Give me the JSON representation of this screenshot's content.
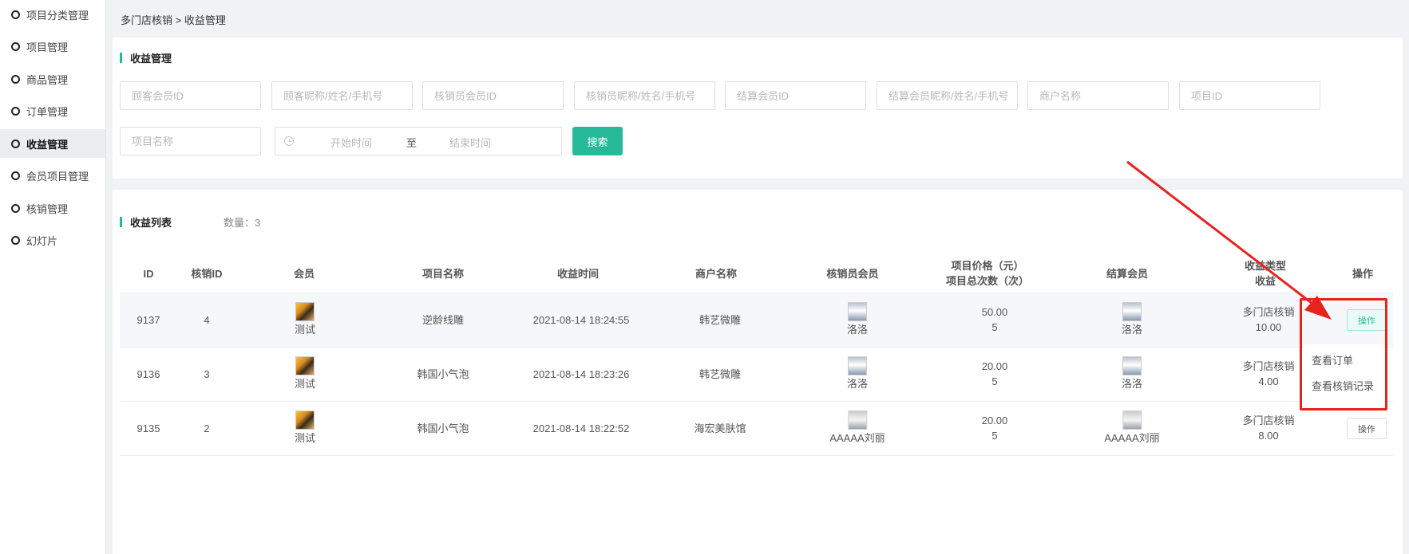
{
  "sidebar": {
    "items": [
      {
        "label": "项目分类管理",
        "active": false
      },
      {
        "label": "项目管理",
        "active": false
      },
      {
        "label": "商品管理",
        "active": false
      },
      {
        "label": "订单管理",
        "active": false
      },
      {
        "label": "收益管理",
        "active": true
      },
      {
        "label": "会员项目管理",
        "active": false
      },
      {
        "label": "核销管理",
        "active": false
      },
      {
        "label": "幻灯片",
        "active": false
      }
    ]
  },
  "breadcrumb": "多门店核销 > 收益管理",
  "search": {
    "title": "收益管理",
    "placeholders": {
      "customer_id": "顾客会员ID",
      "customer_name": "顾客昵称/姓名/手机号",
      "staff_id": "核销员会员ID",
      "staff_name": "核销员昵称/姓名/手机号",
      "settle_id": "结算会员ID",
      "settle_name": "结算会员昵称/姓名/手机号",
      "merchant": "商户名称",
      "project_id": "项目ID",
      "project_name": "项目名称",
      "start_time": "开始时间",
      "end_time": "结束时间"
    },
    "range_sep": "至",
    "search_btn": "搜索"
  },
  "list": {
    "title": "收益列表",
    "count": "数量：3",
    "headers": {
      "id": "ID",
      "verify_id": "核销ID",
      "member": "会员",
      "project": "项目名称",
      "time": "收益时间",
      "merchant": "商户名称",
      "staff": "核销员会员",
      "price_line1": "项目价格（元）",
      "price_line2": "项目总次数（次）",
      "settle": "结算会员",
      "type_line1": "收益类型",
      "type_line2": "收益",
      "op": "操作"
    },
    "rows": [
      {
        "id": "9137",
        "verify_id": "4",
        "member": "测试",
        "project": "逆龄线雕",
        "time": "2021-08-14 18:24:55",
        "merchant": "韩艺微雕",
        "staff": "洛洛",
        "price": "50.00",
        "times": "5",
        "settle": "洛洛",
        "type": "多门店核销",
        "income": "10.00",
        "op": "操作"
      },
      {
        "id": "9136",
        "verify_id": "3",
        "member": "测试",
        "project": "韩国小气泡",
        "time": "2021-08-14 18:23:26",
        "merchant": "韩艺微雕",
        "staff": "洛洛",
        "price": "20.00",
        "times": "5",
        "settle": "洛洛",
        "type": "多门店核销",
        "income": "4.00",
        "op": "操作"
      },
      {
        "id": "9135",
        "verify_id": "2",
        "member": "测试",
        "project": "韩国小气泡",
        "time": "2021-08-14 18:22:52",
        "merchant": "海宏美肤馆",
        "staff": "AAAAA刘丽",
        "price": "20.00",
        "times": "5",
        "settle": "AAAAA刘丽",
        "type": "多门店核销",
        "income": "8.00",
        "op": "操作"
      }
    ],
    "dropdown": [
      "查看订单",
      "查看核销记录"
    ]
  },
  "colors": {
    "accent": "#26b99a",
    "annotation": "#e8231d"
  },
  "icons": {
    "clock": "clock-icon",
    "annotation_arrow": "red-arrow",
    "sidebar_bullet": "circle-icon"
  }
}
